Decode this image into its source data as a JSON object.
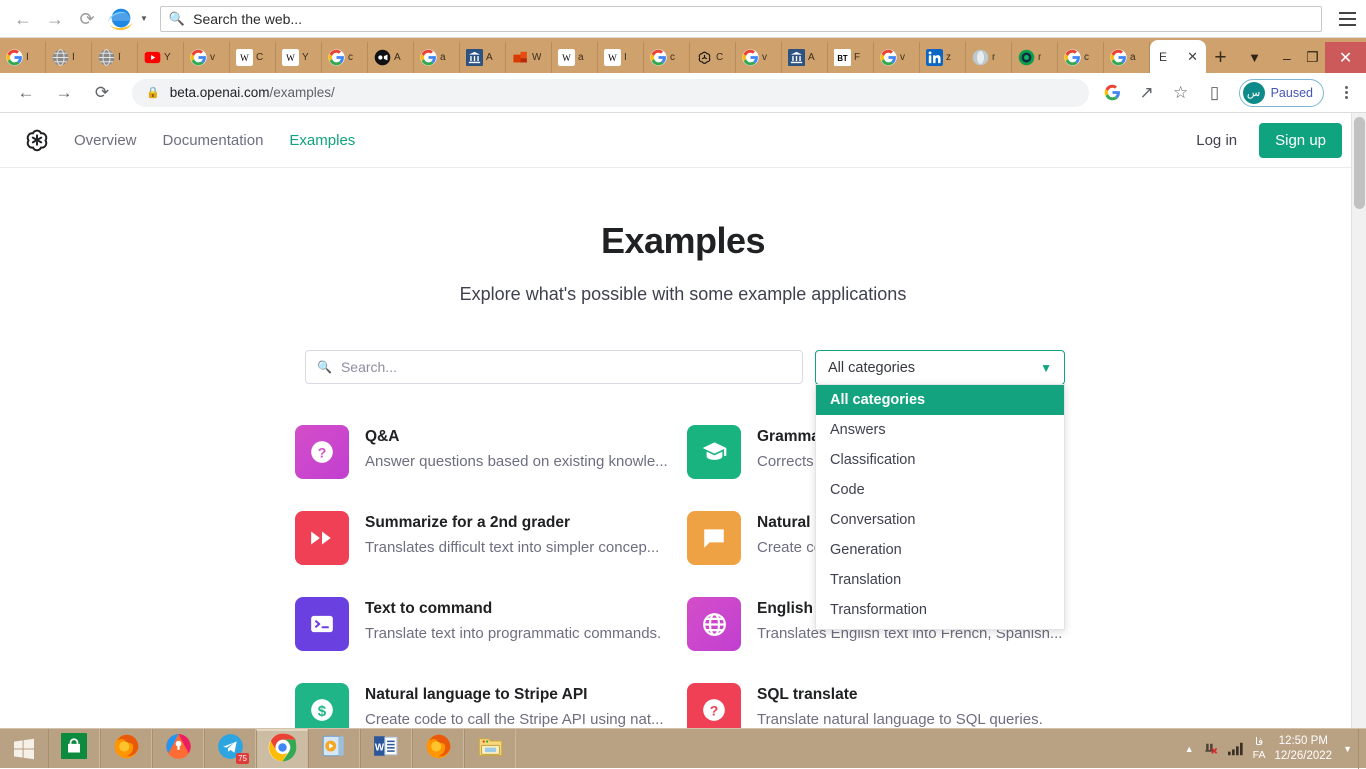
{
  "ie_bar": {
    "back_icon": "back-arrow-icon",
    "forward_icon": "forward-arrow-icon",
    "reload_icon": "reload-icon",
    "brand_icon": "internet-explorer-logo",
    "search_placeholder": "Search the web...",
    "search_icon": "search-icon",
    "menu_icon": "hamburger-menu-icon"
  },
  "browser": {
    "tabs": [
      {
        "favicon": "google-icon",
        "title": "Î"
      },
      {
        "favicon": "globe-icon",
        "title": "Î"
      },
      {
        "favicon": "globe-icon",
        "title": "Î"
      },
      {
        "favicon": "youtube-icon",
        "title": "Y"
      },
      {
        "favicon": "google-icon",
        "title": "v"
      },
      {
        "favicon": "wikipedia-icon",
        "title": "C"
      },
      {
        "favicon": "wikipedia-icon",
        "title": "Y"
      },
      {
        "favicon": "google-icon",
        "title": "c"
      },
      {
        "favicon": "video-icon",
        "title": "A"
      },
      {
        "favicon": "google-icon",
        "title": "a"
      },
      {
        "favicon": "bank-icon",
        "title": "A"
      },
      {
        "favicon": "redoffice-icon",
        "title": "W"
      },
      {
        "favicon": "wikipedia-icon",
        "title": "a"
      },
      {
        "favicon": "wikipedia-icon",
        "title": "I"
      },
      {
        "favicon": "google-icon",
        "title": "c"
      },
      {
        "favicon": "openai-icon",
        "title": "C"
      },
      {
        "favicon": "google-icon",
        "title": "v"
      },
      {
        "favicon": "bank-icon",
        "title": "A"
      },
      {
        "favicon": "bt-icon",
        "title": "F"
      },
      {
        "favicon": "google-icon",
        "title": "v"
      },
      {
        "favicon": "linkedin-icon",
        "title": "z"
      },
      {
        "favicon": "opera-icon",
        "title": "r"
      },
      {
        "favicon": "target-icon",
        "title": "r"
      },
      {
        "favicon": "google-icon",
        "title": "c"
      },
      {
        "favicon": "google-icon",
        "title": "a"
      }
    ],
    "active_tab": {
      "favicon": "openai-icon",
      "title": "E",
      "close_icon": "close-icon"
    },
    "new_tab_label": "+",
    "tab_list_icon": "chevron-down-icon",
    "window_minimize": "–",
    "window_restore": "❐",
    "window_close": "✕",
    "toolbar": {
      "back_icon": "back-arrow-icon",
      "forward_icon": "forward-arrow-icon",
      "reload_icon": "reload-icon",
      "lock_icon": "lock-icon",
      "url_host": "beta.openai.com",
      "url_path": "/examples/",
      "google_icon": "google-icon",
      "share_icon": "share-icon",
      "bookmark_icon": "star-icon",
      "sidepanel_icon": "side-panel-icon",
      "profile_initial": "س",
      "profile_status": "Paused",
      "menu_icon": "three-dot-menu-icon"
    }
  },
  "site": {
    "logo": "openai-logo",
    "nav": [
      {
        "label": "Overview",
        "active": false
      },
      {
        "label": "Documentation",
        "active": false
      },
      {
        "label": "Examples",
        "active": true
      }
    ],
    "login_label": "Log in",
    "signup_label": "Sign up",
    "accent_color": "#10a37f"
  },
  "main": {
    "title": "Examples",
    "subtitle": "Explore what's possible with some example applications",
    "search": {
      "placeholder": "Search...",
      "value": "",
      "icon": "search-icon"
    },
    "category_select": {
      "value": "All categories",
      "chevron_icon": "chevron-down-icon",
      "open": true,
      "options": [
        {
          "label": "All categories",
          "selected": true
        },
        {
          "label": "Answers",
          "selected": false
        },
        {
          "label": "Classification",
          "selected": false
        },
        {
          "label": "Code",
          "selected": false
        },
        {
          "label": "Conversation",
          "selected": false
        },
        {
          "label": "Generation",
          "selected": false
        },
        {
          "label": "Translation",
          "selected": false
        },
        {
          "label": "Transformation",
          "selected": false
        }
      ]
    },
    "cards": [
      {
        "title": "Q&A",
        "desc": "Answer questions based on existing knowle...",
        "icon": "question-mark-icon",
        "color": "#d44ec9",
        "color2": "#c13fd0"
      },
      {
        "title": "Grammar correction",
        "desc": "Corrects sentences into standard English.",
        "icon": "graduation-cap-icon",
        "color": "#19b37f",
        "color2": "#19b37f"
      },
      {
        "title": "Summarize for a 2nd grader",
        "desc": "Translates difficult text into simpler concep...",
        "icon": "fast-forward-icon",
        "color": "#ef4056",
        "color2": "#ef4056"
      },
      {
        "title": "Natural language to OpenAI API",
        "desc": "Create code to call to the OpenAI API usi...",
        "icon": "chat-bubble-icon",
        "color": "#eea243",
        "color2": "#eea243"
      },
      {
        "title": "Text to command",
        "desc": "Translate text into programmatic commands.",
        "icon": "terminal-icon",
        "color": "#6b40e0",
        "color2": "#6b40e0"
      },
      {
        "title": "English to other languages",
        "desc": "Translates English text into French, Spanish...",
        "icon": "globe-icon",
        "color": "#d44ec9",
        "color2": "#c13fd0"
      },
      {
        "title": "Natural language to Stripe API",
        "desc": "Create code to call the Stripe API using nat...",
        "icon": "dollar-icon",
        "color": "#1fb587",
        "color2": "#1fb587"
      },
      {
        "title": "SQL translate",
        "desc": "Translate natural language to SQL queries.",
        "icon": "question-mark-icon",
        "color": "#ef4056",
        "color2": "#ef4056"
      }
    ]
  },
  "taskbar": {
    "start_icon": "windows-start-icon",
    "items": [
      {
        "icon": "microsoft-store-icon",
        "name": "microsoft-store",
        "active": false,
        "badge": ""
      },
      {
        "icon": "firefox-icon",
        "name": "firefox",
        "active": false,
        "badge": ""
      },
      {
        "icon": "avast-icon",
        "name": "avast",
        "active": false,
        "badge": ""
      },
      {
        "icon": "telegram-icon",
        "name": "telegram",
        "active": false,
        "badge": "75"
      },
      {
        "icon": "chrome-icon",
        "name": "chrome",
        "active": true,
        "badge": ""
      },
      {
        "icon": "media-player-icon",
        "name": "media-player",
        "active": false,
        "badge": ""
      },
      {
        "icon": "word-icon",
        "name": "microsoft-word",
        "active": false,
        "badge": ""
      },
      {
        "icon": "firefox-icon",
        "name": "firefox-window",
        "active": false,
        "badge": ""
      },
      {
        "icon": "file-explorer-icon",
        "name": "file-explorer",
        "active": false,
        "badge": ""
      }
    ],
    "tray": {
      "expand_icon": "show-hidden-icons-arrow",
      "network_icon": "network-disconnected-icon",
      "signal_icon": "signal-bars-icon",
      "lang_top": "فا",
      "lang_bottom": "FA",
      "time": "12:50 PM",
      "date": "12/26/2022",
      "notification_icon": "chevron-down-icon"
    }
  }
}
